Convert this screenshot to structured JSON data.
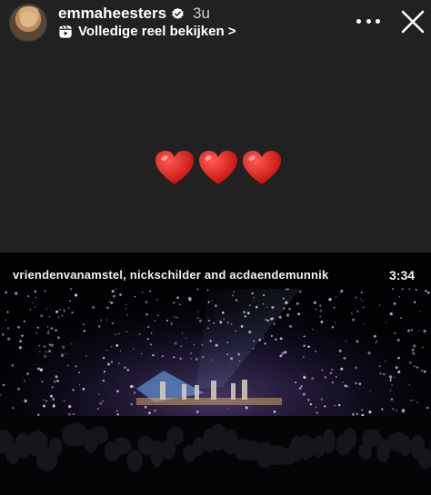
{
  "header": {
    "username": "emmaheesters",
    "time_ago": "3u",
    "reel_link_label": "Volledige reel bekijken >",
    "icons": {
      "avatar": "profile-avatar",
      "verified": "verified-badge-icon",
      "reel": "reel-icon",
      "more": "more-options-icon",
      "close": "close-icon"
    }
  },
  "story": {
    "stickers": [
      "red-heart",
      "red-heart",
      "red-heart"
    ]
  },
  "media": {
    "title": "vriendenvanamstel, nickschilder and acdaendemunnik",
    "duration": "3:34"
  },
  "colors": {
    "background": "#212121",
    "heart": "#e0201b",
    "text": "#ffffff"
  }
}
